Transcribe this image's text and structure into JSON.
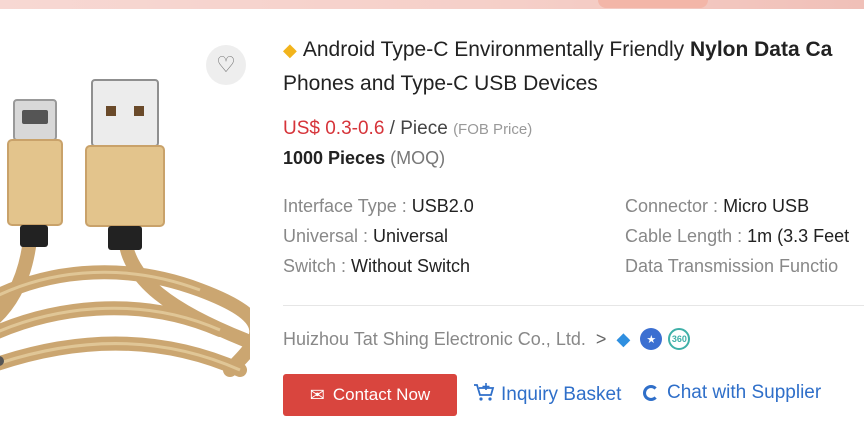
{
  "header": {
    "strip": ""
  },
  "product": {
    "title_prefix": "Android Type-C Environmentally Friendly ",
    "title_bold": "Nylon Data Ca",
    "title_line2": "Phones and Type-C USB Devices",
    "price": "US$ 0.3-0.6",
    "price_unit": " / Piece",
    "price_note": "(FOB Price)",
    "moq_qty": "1000 Pieces",
    "moq_label": "(MOQ)",
    "favorite_icon": "heart-icon"
  },
  "attributes": [
    {
      "key": "Interface Type : ",
      "value": "USB2.0"
    },
    {
      "key": "Connector : ",
      "value": "Micro USB"
    },
    {
      "key": "Universal : ",
      "value": "Universal"
    },
    {
      "key": "Cable Length : ",
      "value": "1m (3.3 Feet"
    },
    {
      "key": "Switch : ",
      "value": "Without Switch"
    },
    {
      "key": "Data Transmission Functio",
      "value": ""
    }
  ],
  "supplier": {
    "name": "Huizhou Tat Shing Electronic Co., Ltd.",
    "chevron": ">",
    "badge_360": "360"
  },
  "actions": {
    "contact": "Contact Now",
    "basket": "Inquiry Basket",
    "chat": "Chat with Supplier"
  },
  "colors": {
    "accent": "#d9453e",
    "link": "#2f6fc9",
    "price": "#d6343a"
  }
}
